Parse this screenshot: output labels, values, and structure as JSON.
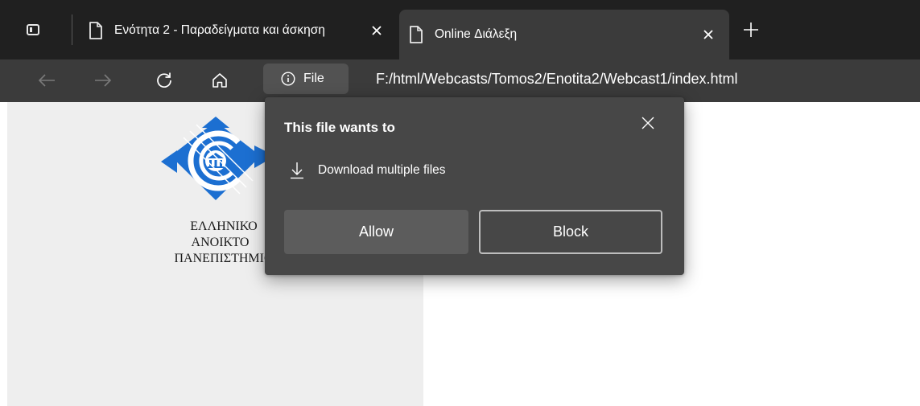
{
  "tabs": [
    {
      "title": "Ενότητα 2 - Παραδείγματα και άσκηση",
      "active": false,
      "close_icon": "close-icon"
    },
    {
      "title": "Online Διάλεξη",
      "active": true,
      "close_icon": "close-icon"
    }
  ],
  "toolbar": {
    "back_icon": "arrow-left-icon",
    "forward_icon": "arrow-right-icon",
    "reload_icon": "refresh-icon",
    "home_icon": "home-icon",
    "site_info_label": "File",
    "url": "F:/html/Webcasts/Tomos2/Enotita2/Webcast1/index.html"
  },
  "page": {
    "university_lines": [
      "ΕΛΛΗΝΙΚΟ",
      "ΑΝΟΙΚΤΟ",
      "ΠΑΝΕΠΙΣΤΗΜΙΟ"
    ],
    "logo_color": "#1c6fd1"
  },
  "popup": {
    "title": "This file wants to",
    "permission": "Download multiple files",
    "allow_label": "Allow",
    "block_label": "Block"
  },
  "colors": {
    "tabstrip": "#202020",
    "toolbar": "#3b3b3b",
    "popup": "#474747",
    "panel": "#eeeeee"
  }
}
